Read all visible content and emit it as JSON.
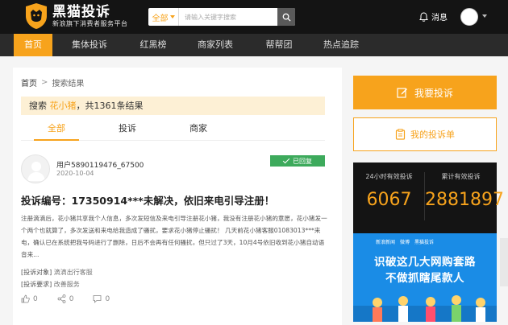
{
  "header": {
    "logo_title": "黑猫投诉",
    "logo_slogan": "新浪旗下消费者服务平台",
    "search_select": "全部",
    "search_placeholder": "请输入关键字搜索",
    "messages_label": "消息"
  },
  "nav": {
    "items": [
      {
        "label": "首页",
        "active": true
      },
      {
        "label": "集体投诉",
        "active": false
      },
      {
        "label": "红黑榜",
        "active": false
      },
      {
        "label": "商家列表",
        "active": false
      },
      {
        "label": "帮帮团",
        "active": false
      },
      {
        "label": "热点追踪",
        "active": false
      }
    ]
  },
  "breadcrumb": {
    "home": "首页",
    "separator": ">",
    "current": "搜索结果"
  },
  "result": {
    "prefix": "搜索",
    "keyword": "花小猪",
    "suffix": "，共1361条结果"
  },
  "tabs": [
    {
      "label": "全部",
      "active": true
    },
    {
      "label": "投诉",
      "active": false
    },
    {
      "label": "商家",
      "active": false
    }
  ],
  "card": {
    "user": "用户5890119476_67500",
    "date": "2020-10-04",
    "badge": "已回复",
    "title": "投诉编号：17350914***未解决，依旧来电引导注册！",
    "body": "注册滴滴后，花小猪共享我个人信息，多次发短信及来电引导注册花小猪，我没有注册花小猪的意愿，花小猪发一个两个也就算了，多次发送和来电给我造成了骚扰，要求花小猪停止骚扰！ 几天前花小猪客服01083013***来电，确认已在系统把我号码进行了删除，日后不会再有任何骚扰，但只过了3天，10月4号依旧收到花小猪自动语音来...",
    "target_label": "[投诉对象]",
    "target_value": "滴滴出行客服",
    "request_label": "[投诉要求]",
    "request_value": "改善服务",
    "likes": "0",
    "shares": "0",
    "comments": "0"
  },
  "sidebar": {
    "complain_button": "我要投诉",
    "my_complaints_button": "我的投诉单",
    "stats": [
      {
        "label": "24小时有效投诉",
        "value": "6067"
      },
      {
        "label": "累计有效投诉",
        "value": "2881897"
      }
    ],
    "ad": {
      "logos": [
        "新浪新闻",
        "微博",
        "黑猫投诉"
      ],
      "line1": "识破这几大网购套路",
      "line2": "不做抓瞎尾款人"
    }
  },
  "colors": {
    "accent": "#f7a31c",
    "header_bg": "#141414",
    "nav_bg": "#2b2b2b",
    "badge_green": "#3daa5c",
    "ad_blue": "#1a8ce6"
  }
}
